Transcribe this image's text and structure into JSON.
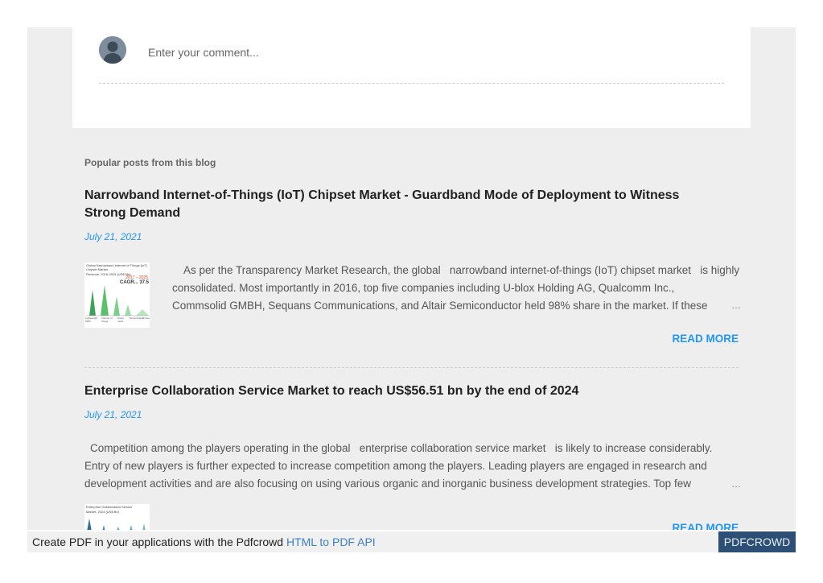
{
  "comment_box": {
    "placeholder": "Enter your comment..."
  },
  "popular": {
    "heading": "Popular posts from this blog",
    "posts": [
      {
        "title": "Narrowband Internet-of-Things (IoT) Chipset Market - Guardband Mode of Deployment to Witness Strong Demand",
        "date": "July 21, 2021",
        "snippet_lines": [
          "As per the Transparency Market Research, the global   narrowband internet-of-things (IoT) chipset market   is highly",
          "consolidated. Most importantly in 2016, top five companies including U-blox Holding AG, Qualcomm Inc.,",
          "Commsolid GMBH, Sequans Communications, and Altair Semiconductor held 98% share in the market. If these"
        ],
        "ellipsis": "…",
        "read_more": "READ MORE",
        "thumbnail": {
          "title": "Global Narrowband Internet of Things (IoT) Chipset Market",
          "subtitle": "Revenue, 2016-2025 (US$ Mn)",
          "range": "2017 – 2025",
          "cagr": "CAGR... 37.5",
          "labels": [
            "Lightweight M2M",
            "Internet of things",
            "Smart meter",
            "Sensors",
            "Healthcare"
          ]
        }
      },
      {
        "title": "Enterprise Collaboration Service Market to reach US$56.51 bn by the end of 2024",
        "date": "July 21, 2021",
        "snippet_lines": [
          "Competition among the players operating in the global   enterprise collaboration service market   is likely to increase considerably.",
          "Entry of new players is further expected to increase competition among the players. Leading players are engaged in research and",
          "development activities and are also focusing on using various organic and inorganic business development strategies. Top few"
        ],
        "ellipsis": "…",
        "read_more": "READ MORE",
        "thumbnail": {
          "title": "Enterprise Collaboration Service",
          "subtitle": "Market, 2024 (US$ Bn)"
        }
      }
    ]
  },
  "footer": {
    "text": "Create PDF in your applications with the Pdfcrowd ",
    "link": "HTML to PDF API",
    "badge": "PDFCROWD"
  },
  "colors": {
    "accent": "#2196f3",
    "page_bg": "#eeeeee",
    "badge_bg": "#2d4f75"
  }
}
